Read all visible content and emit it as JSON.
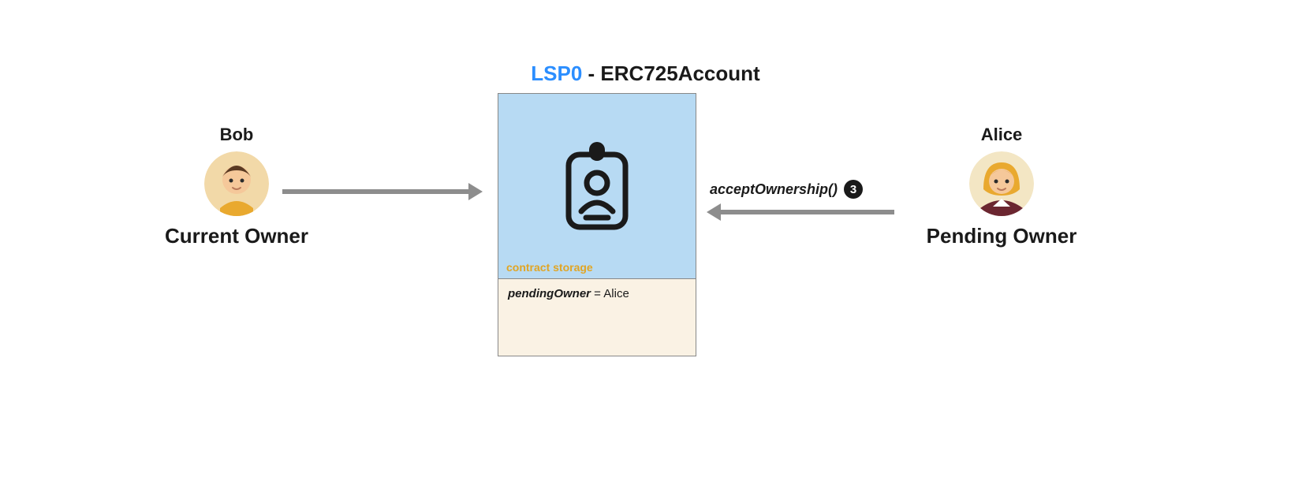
{
  "title": {
    "prefix": "LSP0",
    "suffix": " - ERC725Account"
  },
  "actors": {
    "left": {
      "name": "Bob",
      "role": "Current Owner"
    },
    "right": {
      "name": "Alice",
      "role": "Pending Owner"
    }
  },
  "contract": {
    "storage_label": "contract storage",
    "pending_key": "pendingOwner",
    "pending_eq": " = ",
    "pending_value": "Alice"
  },
  "call": {
    "text": "acceptOwnership()",
    "step": "3"
  }
}
